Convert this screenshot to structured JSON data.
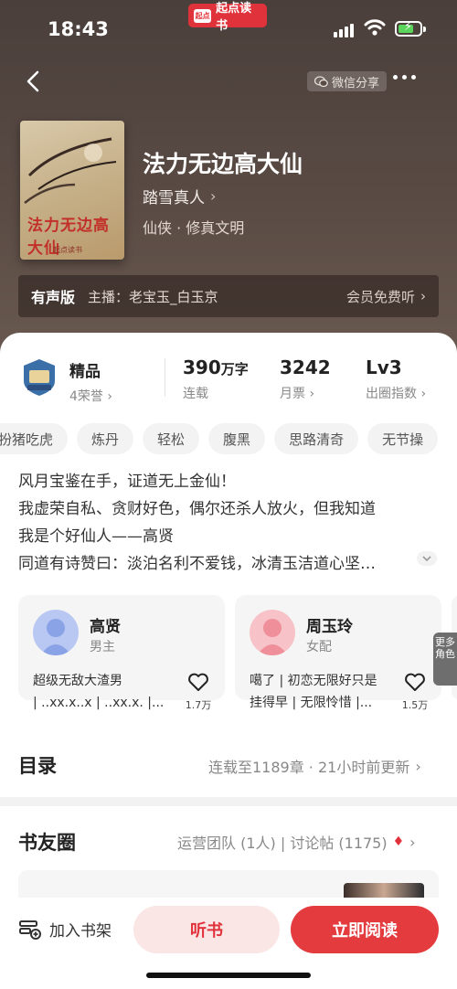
{
  "status_bar": {
    "time": "18:43",
    "app_name": "起点读书",
    "app_mini": "起点"
  },
  "nav": {
    "share_label": "微信分享"
  },
  "book": {
    "title": "法力无边高大仙",
    "author": "踏雪真人",
    "genre": "仙侠 · 修真文明",
    "cover_title": "法力无边高大仙",
    "cover_brand": "起点读书"
  },
  "audio": {
    "tag": "有声版",
    "host": "主播：老宝玉_白玉京",
    "vip": "会员免费听"
  },
  "stats": {
    "quality": {
      "label": "精品",
      "sub": "4荣誉"
    },
    "words": {
      "value": "390",
      "unit": "万字",
      "sub": "连载"
    },
    "tickets": {
      "value": "3242",
      "sub": "月票"
    },
    "level": {
      "value": "Lv3",
      "sub": "出圈指数"
    }
  },
  "tags": [
    "扮猪吃虎",
    "炼丹",
    "轻松",
    "腹黑",
    "思路清奇",
    "无节操"
  ],
  "synopsis": [
    "风月宝鉴在手，证道无上金仙！",
    "我虚荣自私、贪财好色，偶尔还杀人放火，但我知道",
    "我是个好仙人——高贤",
    "同道有诗赞曰：淡泊名利不爱钱，冰清玉洁道心坚…"
  ],
  "characters": [
    {
      "name": "高贤",
      "role": "男主",
      "desc1": "超级无敌大渣男",
      "desc2": "| ..xx.x..x | ..xx.x. |...",
      "likes": "1.7万"
    },
    {
      "name": "周玉玲",
      "role": "女配",
      "desc1": "噶了 | 初恋无限好只是",
      "desc2": "挂得早 | 无限怜惜 |...",
      "likes": "1.5万"
    }
  ],
  "more_roles": "更多角色",
  "toc": {
    "title": "目录",
    "info": "连载至1189章 · 21小时前更新"
  },
  "club": {
    "title": "书友圈",
    "info": "运营团队 (1人) | 讨论帖 (1175)"
  },
  "bottom": {
    "shelf": "加入书架",
    "listen": "听书",
    "read": "立即阅读"
  },
  "colors": {
    "accent": "#e33b3e",
    "header": "#4a3f3b"
  }
}
